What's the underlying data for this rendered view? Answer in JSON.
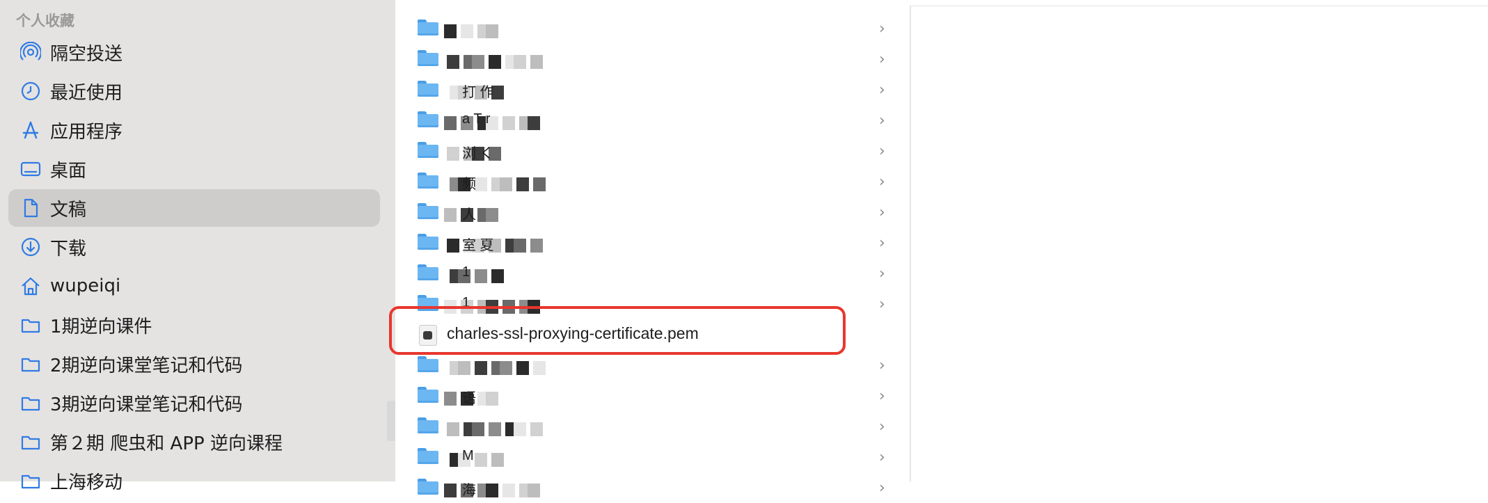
{
  "sidebar": {
    "header": "个人收藏",
    "items": [
      {
        "label": "隔空投送",
        "icon": "airdrop-icon",
        "selected": false
      },
      {
        "label": "最近使用",
        "icon": "clock-icon",
        "selected": false
      },
      {
        "label": "应用程序",
        "icon": "applications-icon",
        "selected": false
      },
      {
        "label": "桌面",
        "icon": "desktop-icon",
        "selected": false
      },
      {
        "label": "文稿",
        "icon": "document-icon",
        "selected": true
      },
      {
        "label": "下载",
        "icon": "download-icon",
        "selected": false
      },
      {
        "label": "wupeiqi",
        "icon": "home-icon",
        "selected": false
      },
      {
        "label": "1期逆向课件",
        "icon": "folder-icon",
        "selected": false
      },
      {
        "label": "2期逆向课堂笔记和代码",
        "icon": "folder-icon",
        "selected": false
      },
      {
        "label": "3期逆向课堂笔记和代码",
        "icon": "folder-icon",
        "selected": false
      },
      {
        "label": "第２期 爬虫和 APP 逆向课程",
        "icon": "folder-icon",
        "selected": false
      },
      {
        "label": "上海移动",
        "icon": "folder-icon",
        "selected": false
      }
    ]
  },
  "file_list": {
    "highlighted_file": {
      "name": "charles-ssl-proxying-certificate.pem",
      "icon": "pem-file-icon"
    },
    "rows": [
      {
        "type": "folder",
        "text": ""
      },
      {
        "type": "folder",
        "text": ""
      },
      {
        "type": "folder",
        "text": "打 作"
      },
      {
        "type": "folder",
        "text": "a T r"
      },
      {
        "type": "folder",
        "text": "浏 く"
      },
      {
        "type": "folder",
        "text": "频"
      },
      {
        "type": "folder",
        "text": "人"
      },
      {
        "type": "folder",
        "text": "室 夏"
      },
      {
        "type": "folder",
        "text": "1"
      },
      {
        "type": "folder",
        "text": "1"
      },
      {
        "type": "file",
        "text": "charles-ssl-proxying-certificate.pem"
      },
      {
        "type": "folder",
        "text": ""
      },
      {
        "type": "folder",
        "text": "语"
      },
      {
        "type": "folder",
        "text": ""
      },
      {
        "type": "folder",
        "text": "M"
      },
      {
        "type": "folder",
        "text": "海"
      }
    ]
  },
  "colors": {
    "sidebar_bg": "#e4e3e1",
    "selected_bg": "#cfcdcb",
    "accent_blue": "#2f7ae5",
    "highlight_red": "#e8362e",
    "folder_blue": "#6cb6f2"
  }
}
